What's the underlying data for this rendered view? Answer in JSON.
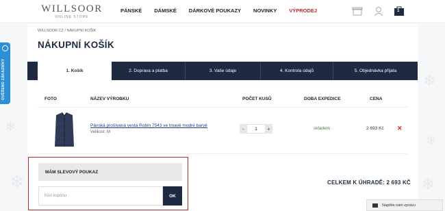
{
  "header": {
    "logo_main": "WILLSOOR",
    "logo_sub": "ONLINE STORE",
    "nav": [
      "PÁNSKÉ",
      "DÁMSKÉ",
      "DÁRKOVÉ POUKAZY",
      "NOVINKY",
      "VÝPRODEJ"
    ],
    "cart_count": "1"
  },
  "breadcrumb": "WILLSOOR.CZ / NÁKUPNÍ KOŠÍK",
  "page_title": "NÁKUPNÍ KOŠÍK",
  "steps": [
    "1. Košík",
    "2. Doprava a platba",
    "3. Vaše údaje",
    "4. Kontrola údajů",
    "5. Objednávka přijata"
  ],
  "table": {
    "headers": [
      "FOTO",
      "NÁZEV VÝROBKU",
      "POČET KUSŮ",
      "DOBA EXPEDICE",
      "CENA"
    ],
    "rows": [
      {
        "name": "Pánská prošívaná vesta Robin 7543 ve tmavě modré barvě",
        "size": "Velikost: M",
        "qty": "1",
        "minus": "-",
        "plus": "+",
        "delivery": "skladem",
        "price": "2 693 Kč",
        "remove": "✕"
      }
    ]
  },
  "coupon": {
    "title": "MÁM SLEVOVÝ POUKAZ",
    "placeholder": "Kód kupónu",
    "button": "OK"
  },
  "total": "CELKEM K ÚHRADĚ: 2 693 KČ",
  "side_badge": "OVĚŘENO ZÁKAZNÍKY",
  "chat": "Napište nám zprávu",
  "colors": {
    "navy": "#1e2a3f",
    "sale_red": "#c0272d",
    "stock_green": "#3c8a3c",
    "badge_blue": "#2d8fd5"
  }
}
